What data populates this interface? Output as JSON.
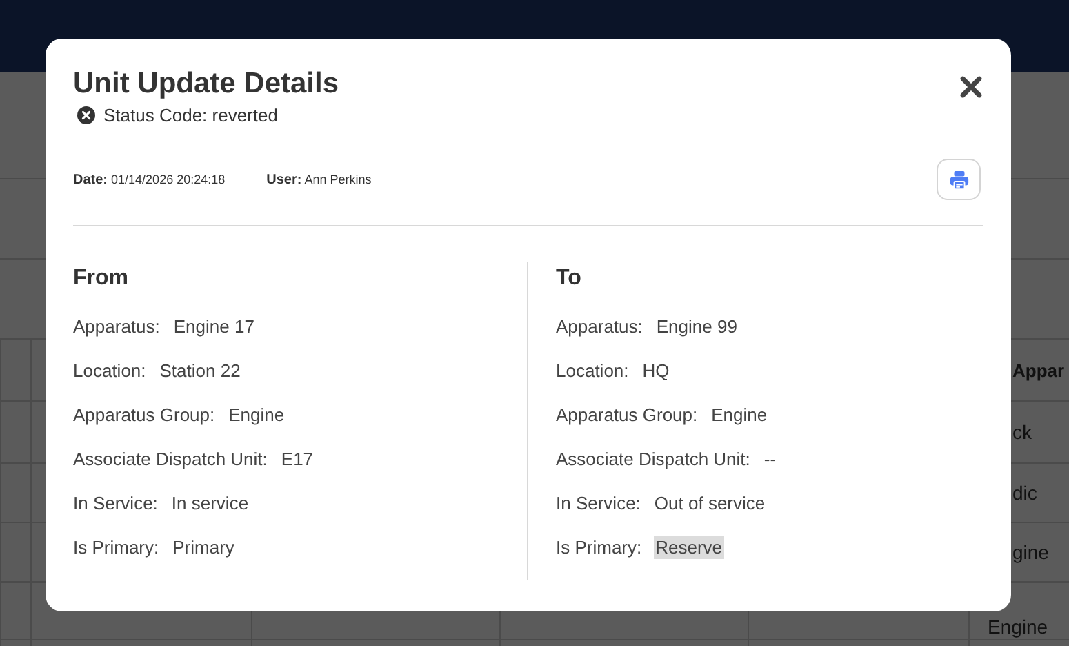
{
  "background": {
    "column_header": "Appar",
    "cells": [
      "ck",
      "dic",
      "gine",
      "Engine"
    ]
  },
  "modal": {
    "title": "Unit Update Details",
    "status": "Status Code: reverted",
    "meta": [
      {
        "label": "Date:",
        "value": "01/14/2026 20:24:18"
      },
      {
        "label": "User:",
        "value": "Ann Perkins"
      }
    ],
    "columns": [
      {
        "heading": "From",
        "fields": [
          {
            "label": "Apparatus:",
            "value": "Engine 17",
            "highlighted": false
          },
          {
            "label": "Location:",
            "value": "Station 22",
            "highlighted": false
          },
          {
            "label": "Apparatus Group:",
            "value": "Engine",
            "highlighted": false
          },
          {
            "label": "Associate Dispatch Unit:",
            "value": "E17",
            "highlighted": false
          },
          {
            "label": "In Service:",
            "value": "In service",
            "highlighted": false
          },
          {
            "label": "Is Primary:",
            "value": "Primary",
            "highlighted": false
          }
        ]
      },
      {
        "heading": "To",
        "fields": [
          {
            "label": "Apparatus:",
            "value": "Engine 99",
            "highlighted": false
          },
          {
            "label": "Location:",
            "value": "HQ",
            "highlighted": false
          },
          {
            "label": "Apparatus Group:",
            "value": "Engine",
            "highlighted": false
          },
          {
            "label": "Associate Dispatch Unit:",
            "value": "--",
            "highlighted": false
          },
          {
            "label": "In Service:",
            "value": "Out of service",
            "highlighted": false
          },
          {
            "label": "Is Primary:",
            "value": "Reserve",
            "highlighted": true
          }
        ]
      }
    ]
  }
}
